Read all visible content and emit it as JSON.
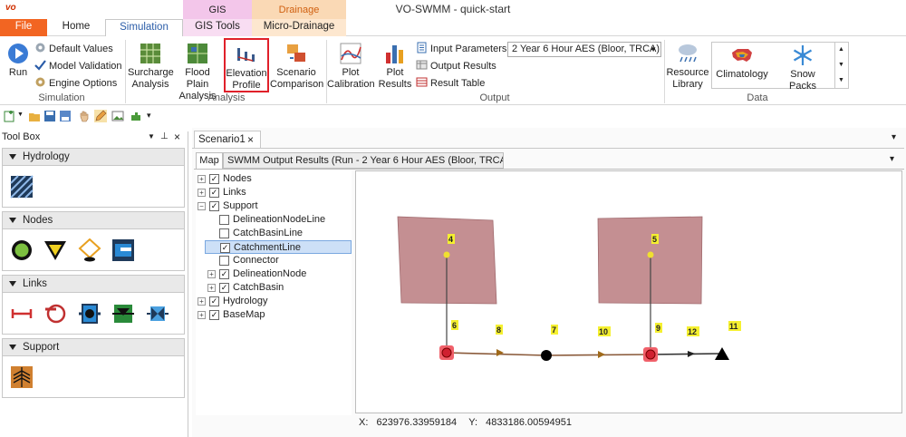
{
  "app": {
    "logo": "vo",
    "title": "VO-SWMM - quick-start"
  },
  "context_groups": {
    "gis": "GIS",
    "drainage": "Drainage"
  },
  "tabs": [
    "File",
    "Home",
    "Simulation",
    "GIS Tools",
    "Micro-Drainage"
  ],
  "ribbon": {
    "simulation": {
      "run": "Run",
      "default_values": "Default Values",
      "model_validation": "Model Validation",
      "engine_options": "Engine Options",
      "label": "Simulation"
    },
    "analysis": {
      "surcharge_1": "Surcharge",
      "surcharge_2": "Analysis",
      "flood_1": "Flood Plain",
      "flood_2": "Analysis",
      "elev_1": "Elevation",
      "elev_2": "Profile",
      "scen_1": "Scenario",
      "scen_2": "Comparison",
      "label": "Analysis"
    },
    "output": {
      "plotcal_1": "Plot",
      "plotcal_2": "Calibration",
      "plotres_1": "Plot",
      "plotres_2": "Results",
      "input_params": "Input Parameters",
      "output_results": "Output Results",
      "result_table": "Result Table",
      "run_select": "2 Year 6 Hour AES (Bloor, TRCA)",
      "label": "Output"
    },
    "data": {
      "resource_1": "Resource",
      "resource_2": "Library",
      "climatology": "Climatology",
      "snow_packs": "Snow Packs",
      "label": "Data"
    }
  },
  "toolbox": {
    "title": "Tool Box",
    "sections": [
      "Hydrology",
      "Nodes",
      "Links",
      "Support"
    ]
  },
  "document": {
    "tab": "Scenario1",
    "subtabs": [
      "Map",
      "SWMM Output Results (Run - 2 Year 6 Hour AES (Bloor, TRCA))"
    ]
  },
  "tree": [
    {
      "label": "Nodes",
      "checked": true,
      "expand": "+"
    },
    {
      "label": "Links",
      "checked": true,
      "expand": "+"
    },
    {
      "label": "Support",
      "checked": true,
      "expand": "-"
    },
    {
      "label": "DelineationNodeLine",
      "checked": false,
      "expand": ""
    },
    {
      "label": "CatchBasinLine",
      "checked": false,
      "expand": ""
    },
    {
      "label": "CatchmentLine",
      "checked": true,
      "expand": ""
    },
    {
      "label": "Connector",
      "checked": false,
      "expand": ""
    },
    {
      "label": "DelineationNode",
      "checked": true,
      "expand": "+"
    },
    {
      "label": "CatchBasin",
      "checked": true,
      "expand": "+"
    },
    {
      "label": "Hydrology",
      "checked": true,
      "expand": "+"
    },
    {
      "label": "BaseMap",
      "checked": true,
      "expand": "+"
    }
  ],
  "map": {
    "labels": [
      "4",
      "5",
      "6",
      "7",
      "8",
      "9",
      "10",
      "11",
      "12"
    ]
  },
  "status": {
    "x_label": "X:",
    "x_value": "623976.33959184",
    "y_label": "Y:",
    "y_value": "4833186.00594951"
  },
  "colors": {
    "accent": "#2a5ca8",
    "file_tab": "#f26522",
    "gis_group": "#f3c6ea",
    "drainage_group": "#fad9b5",
    "catchment_fill": "#c48f92",
    "highlight": "#cde0f7",
    "selection_box": "#e0202a"
  }
}
